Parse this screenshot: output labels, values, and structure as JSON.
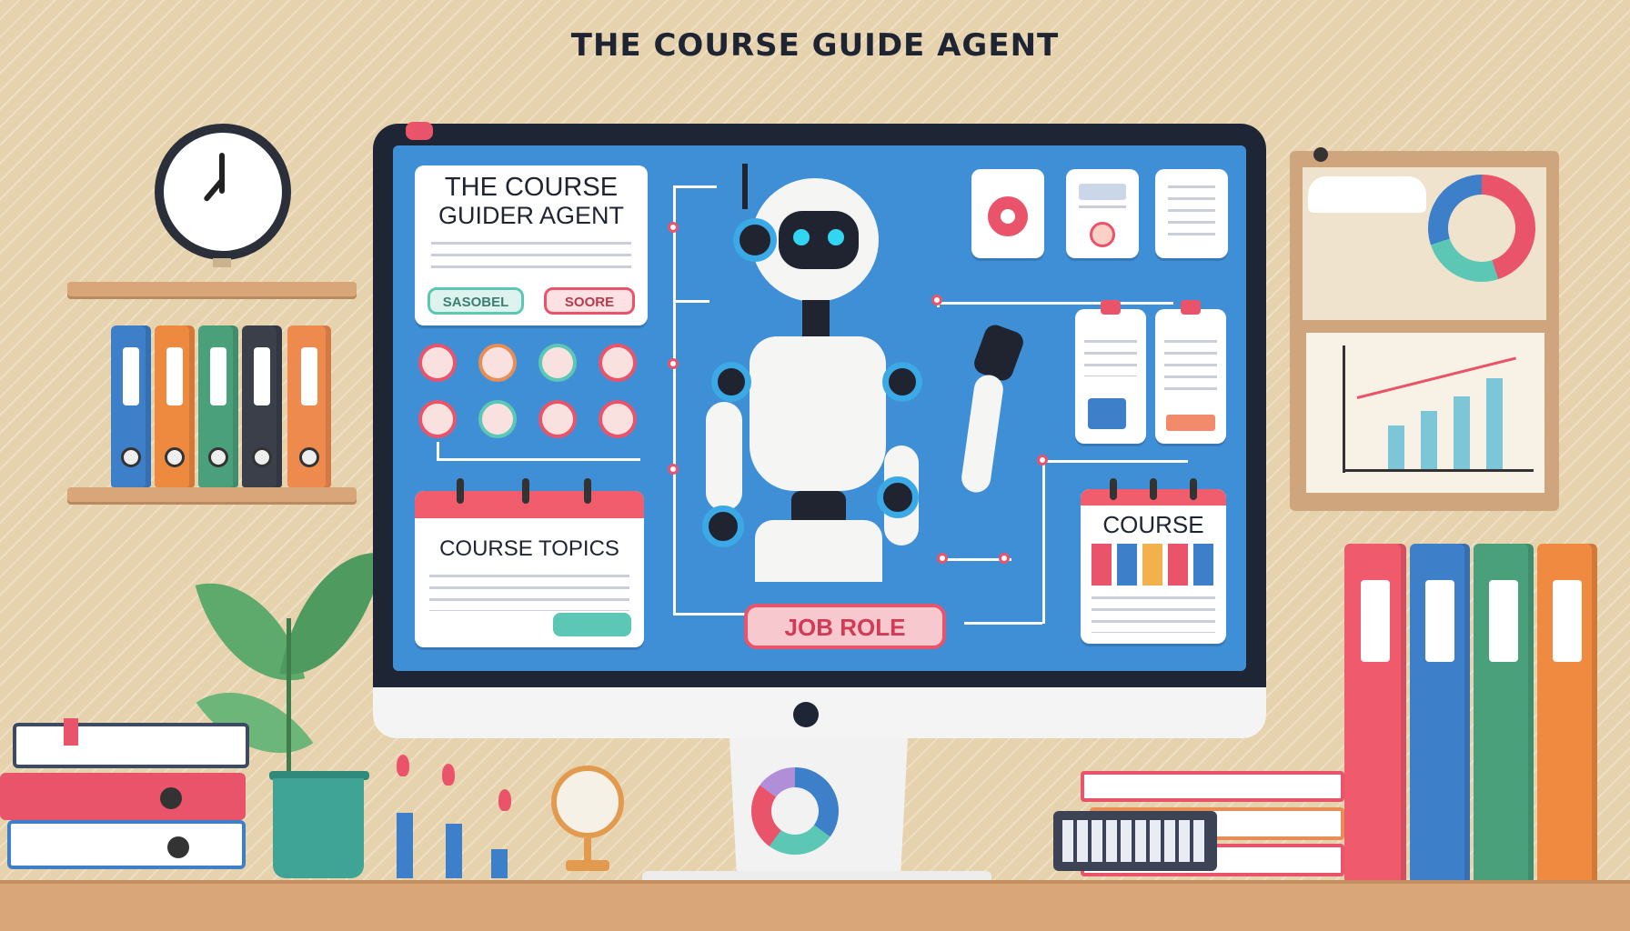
{
  "header": {
    "title": "THE COURSE GUIDE AGENT"
  },
  "screen": {
    "main_card": {
      "title_line1": "THE COURSE",
      "title_line2": "GUIDER AGENT",
      "button_left": "SASOBEL",
      "button_right": "SOORE"
    },
    "topics_card": {
      "title": "COURSE TOPICS"
    },
    "course_card": {
      "title": "COURSE"
    },
    "job_role_button": "JOB ROLE"
  },
  "colors": {
    "wall": "#e6d3ae",
    "screen": "#3f8fd6",
    "accent_red": "#e9546b",
    "accent_teal": "#5cc7b5",
    "robot_eye": "#33d6f2"
  },
  "icons": [
    "clock-icon",
    "robot-icon",
    "gear-icon",
    "document-icon",
    "globe-icon",
    "plant-icon",
    "donut-chart-icon",
    "bar-chart-icon"
  ]
}
